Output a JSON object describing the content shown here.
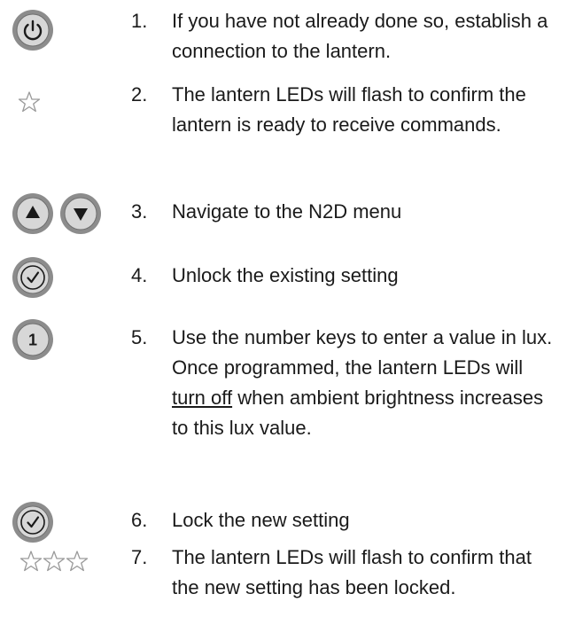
{
  "steps": [
    {
      "number": "1.",
      "icon": "power-button-icon",
      "text": "If you have not already done so, establish a connection to the lantern."
    },
    {
      "number": "2.",
      "icon": "single-star-icon",
      "text": "The lantern LEDs will flash to confirm the lantern is ready to receive commands."
    },
    {
      "number": "3.",
      "icon": "up-down-arrow-buttons-icon",
      "text": "Navigate to the N2D menu"
    },
    {
      "number": "4.",
      "icon": "check-button-icon",
      "text": "Unlock the existing setting"
    },
    {
      "number": "5.",
      "icon": "number-one-button-icon",
      "text_before": "Use the number keys to enter a value in lux. Once programmed, the lantern LEDs will ",
      "text_underlined": "turn off",
      "text_after": " when ambient brightness increases to this lux value.",
      "key_label": "1"
    },
    {
      "number": "6.",
      "icon": "check-button-icon",
      "text": "Lock the new setting"
    },
    {
      "number": "7.",
      "icon": "three-stars-icon",
      "text": "The lantern LEDs will flash to confirm that the new setting has been locked."
    }
  ],
  "colors": {
    "button_outer": "#8c8c8c",
    "button_face": "#d7d7d7",
    "button_symbol": "#1a1a1a",
    "star_stroke": "#9a9a9a"
  }
}
